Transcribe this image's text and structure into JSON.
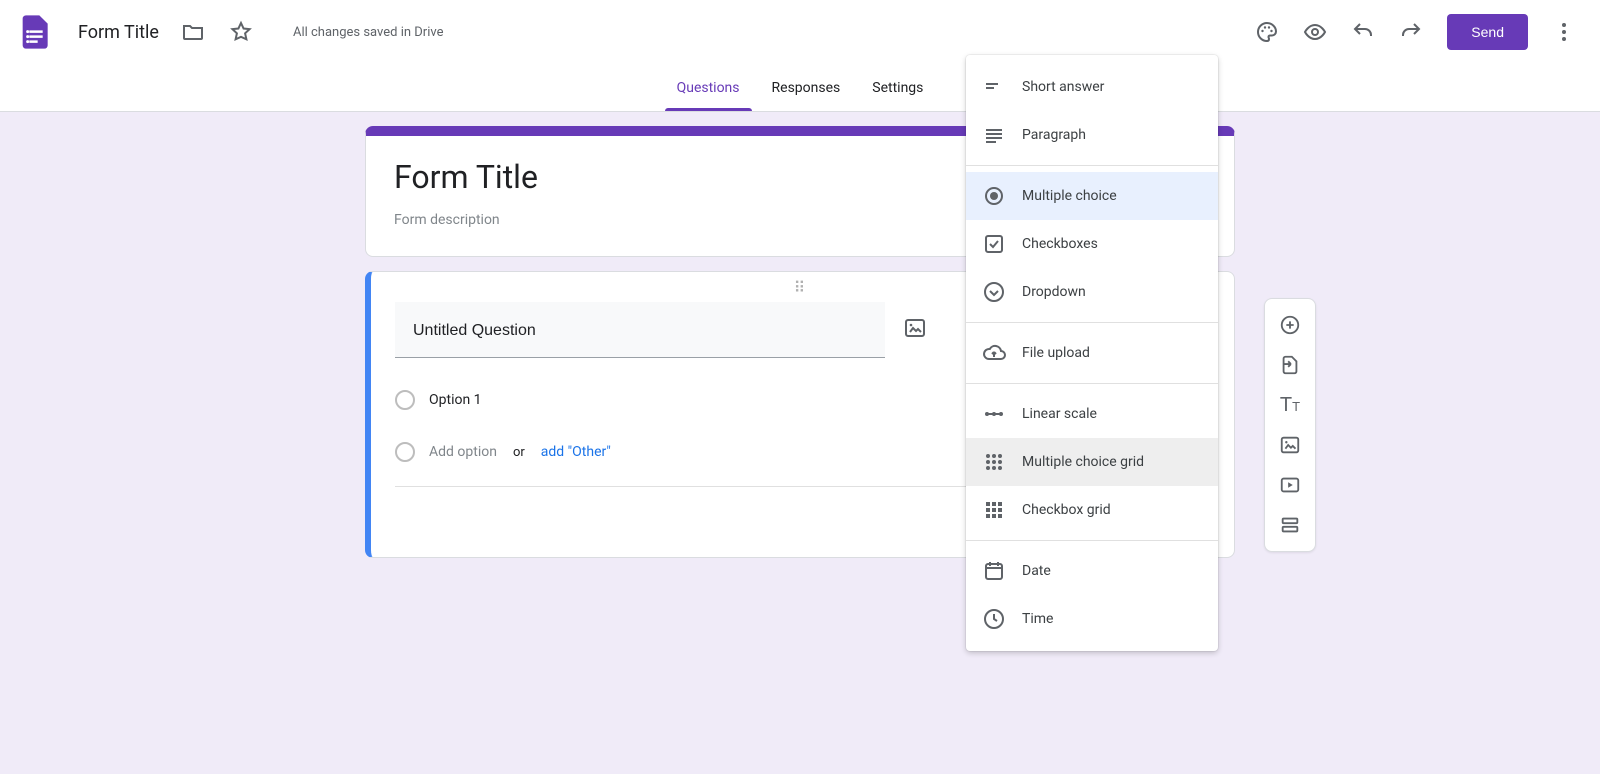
{
  "header": {
    "doc_title": "Form Title",
    "save_status": "All changes saved in Drive",
    "send_label": "Send"
  },
  "tabs": [
    {
      "label": "Questions",
      "active": true
    },
    {
      "label": "Responses",
      "active": false
    },
    {
      "label": "Settings",
      "active": false
    }
  ],
  "form": {
    "title": "Form Title",
    "description_placeholder": "Form description"
  },
  "question": {
    "title": "Untitled Question",
    "options": [
      "Option 1"
    ],
    "add_option_label": "Add option",
    "or_label": "or",
    "add_other_label": "add \"Other\""
  },
  "type_menu": {
    "items": [
      {
        "icon": "short-text-icon",
        "label": "Short answer"
      },
      {
        "icon": "paragraph-icon",
        "label": "Paragraph"
      },
      {
        "sep": true
      },
      {
        "icon": "radio-icon",
        "label": "Multiple choice",
        "selected": true
      },
      {
        "icon": "checkbox-icon",
        "label": "Checkboxes"
      },
      {
        "icon": "dropdown-icon",
        "label": "Dropdown"
      },
      {
        "sep": true
      },
      {
        "icon": "cloud-upload-icon",
        "label": "File upload"
      },
      {
        "sep": true
      },
      {
        "icon": "linear-scale-icon",
        "label": "Linear scale"
      },
      {
        "icon": "grid-radio-icon",
        "label": "Multiple choice grid",
        "hovered": true
      },
      {
        "icon": "grid-check-icon",
        "label": "Checkbox grid"
      },
      {
        "sep": true
      },
      {
        "icon": "date-icon",
        "label": "Date"
      },
      {
        "icon": "time-icon",
        "label": "Time"
      }
    ]
  },
  "side_toolbar": {
    "items": [
      "add-question-icon",
      "import-questions-icon",
      "add-title-icon",
      "add-image-icon",
      "add-video-icon",
      "add-section-icon"
    ]
  },
  "colors": {
    "accent": "#673ab7",
    "link": "#1a73e8",
    "background": "#f0ebf8"
  }
}
